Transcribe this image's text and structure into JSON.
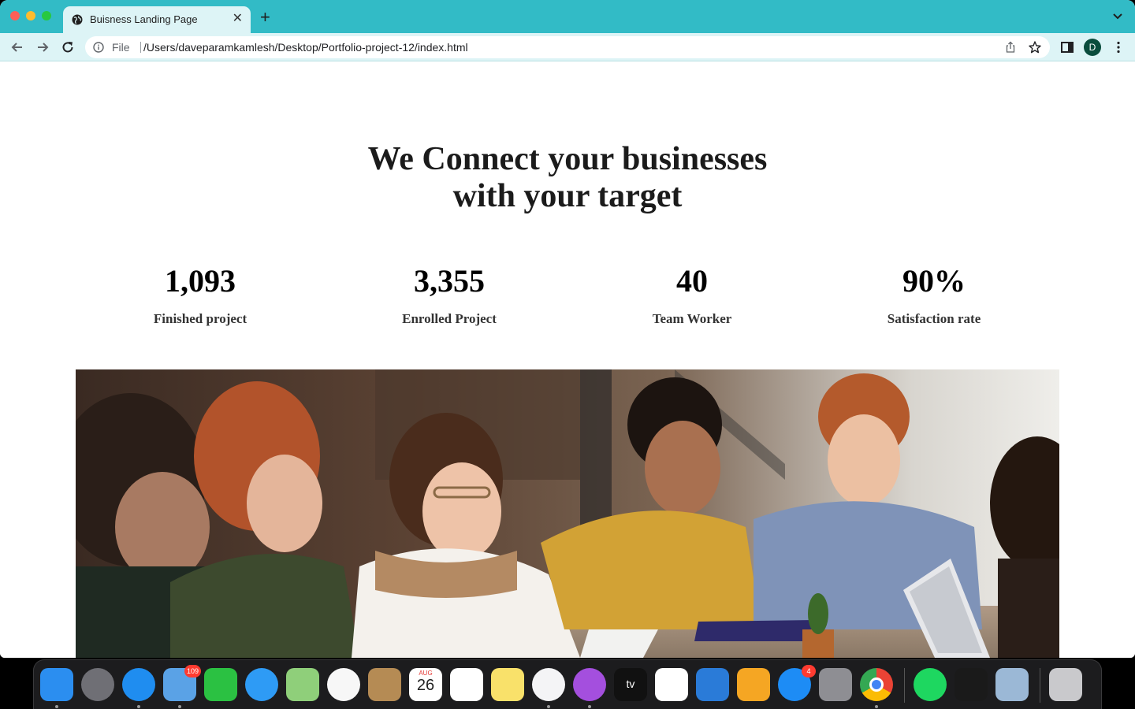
{
  "browser": {
    "tab_title": "Buisness Landing Page",
    "url_scheme": "File",
    "url": "/Users/daveparamkamlesh/Desktop/Portfolio-project-12/index.html",
    "profile_initial": "D",
    "accent_color": "#32bbc6"
  },
  "hero": {
    "title_line1": "We Connect your businesses",
    "title_line2": "with your target"
  },
  "stats": [
    {
      "value": "1,093",
      "label": "Finished project"
    },
    {
      "value": "3,355",
      "label": "Enrolled Project"
    },
    {
      "value": "40",
      "label": "Team Worker"
    },
    {
      "value": "90%",
      "label": "Satisfaction rate"
    }
  ],
  "dock": {
    "items": [
      {
        "name": "finder-icon",
        "color": "#2b8ef0",
        "running": true
      },
      {
        "name": "launchpad-icon",
        "color": "#6f6f75",
        "running": false
      },
      {
        "name": "safari-icon",
        "color": "#1f8df0",
        "running": true
      },
      {
        "name": "mail-icon",
        "color": "#5aa2e6",
        "running": true,
        "badge": "109"
      },
      {
        "name": "facetime-icon",
        "color": "#2bc142",
        "running": false
      },
      {
        "name": "messages-icon",
        "color": "#2e9bf5",
        "running": false
      },
      {
        "name": "maps-icon",
        "color": "#8fcf7a",
        "running": false
      },
      {
        "name": "photos-icon",
        "color": "#f7f7f7",
        "running": false
      },
      {
        "name": "contacts-icon",
        "color": "#b58b54",
        "running": false
      },
      {
        "name": "calendar-icon",
        "color": "#ffffff",
        "running": false,
        "label_month": "AUG",
        "label_day": "26"
      },
      {
        "name": "reminders-icon",
        "color": "#ffffff",
        "running": false
      },
      {
        "name": "notes-icon",
        "color": "#f9e16a",
        "running": false
      },
      {
        "name": "music-icon",
        "color": "#f4f4f6",
        "running": true
      },
      {
        "name": "podcasts-icon",
        "color": "#a44fde",
        "running": true
      },
      {
        "name": "tv-icon",
        "color": "#111111",
        "running": false,
        "label": "tv"
      },
      {
        "name": "numbers-icon",
        "color": "#ffffff",
        "running": false
      },
      {
        "name": "keynote-icon",
        "color": "#2a7bd8",
        "running": false
      },
      {
        "name": "pages-icon",
        "color": "#f5a623",
        "running": false
      },
      {
        "name": "app-store-icon",
        "color": "#1d8cf5",
        "running": false,
        "badge": "4"
      },
      {
        "name": "system-preferences-icon",
        "color": "#8e8e93",
        "running": false
      },
      {
        "name": "chrome-icon",
        "color": "#ffffff",
        "running": true
      },
      {
        "name": "spotify-icon",
        "color": "#1ed760",
        "running": false
      },
      {
        "name": "terminal-icon",
        "color": "#1a1a1a",
        "running": false
      },
      {
        "name": "preview-icon",
        "color": "#9bb8d6",
        "running": false
      },
      {
        "name": "trash-icon",
        "color": "#c9c9cc",
        "running": false
      }
    ]
  }
}
